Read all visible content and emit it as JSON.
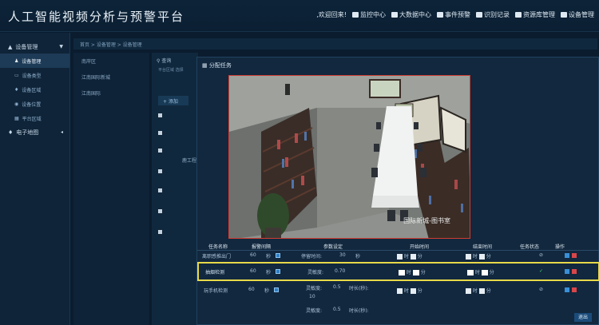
{
  "header": {
    "title": "人工智能视频分析与预警平台",
    "welcome": ",欢迎回来!",
    "nav": [
      "监控中心",
      "大数据中心",
      "事件预警",
      "识别记录",
      "资源库管理",
      "设备管理"
    ]
  },
  "sidebar": {
    "items": [
      {
        "label": "设备管理",
        "icon": "thumbs-up-icon"
      },
      {
        "label": "设备管理",
        "icon": "person-icon"
      },
      {
        "label": "设备类型",
        "icon": "monitor-icon"
      },
      {
        "label": "设备区域",
        "icon": "pin-icon"
      },
      {
        "label": "设备位置",
        "icon": "target-icon"
      },
      {
        "label": "平台区域",
        "icon": "grid-icon"
      },
      {
        "label": "电子地图",
        "icon": "pin-icon"
      }
    ]
  },
  "breadcrumb": "首页 > 设备管理 > 设备管理",
  "tree": {
    "items": [
      "南岸区",
      "江南国际新城",
      "江南国际"
    ]
  },
  "mid": {
    "search": "查询",
    "head1": "平台区域",
    "head2": "选择",
    "add": "添加",
    "frag": "鹿工程"
  },
  "modal": {
    "title": "分配任务",
    "camera_label": "国际新城-图书室",
    "columns": [
      "任务名称",
      "报警间隔",
      "参数设定",
      "开始时间",
      "结束时间",
      "任务状态",
      "操作"
    ],
    "rows": [
      {
        "name": "离职感推出门",
        "interval": "60",
        "unit": "秒",
        "param_label": "停留时间:",
        "param_value": "30",
        "param_unit": "秒",
        "status": "⊘"
      },
      {
        "name": "抽烟检测",
        "interval": "60",
        "unit": "秒",
        "param_label": "灵敏度:",
        "param_value": "0.70",
        "status": "✓"
      },
      {
        "name": "玩手机检测",
        "interval": "60",
        "unit": "秒",
        "param_label": "灵敏度:",
        "param_value": "0.5",
        "extra_label": "时长(秒):",
        "extra_value": "10",
        "status": "⊘"
      },
      {
        "param_label": "灵敏度:",
        "param_value": "0.5",
        "extra_label": "时长(秒):"
      }
    ],
    "hour_label": "时",
    "minute_label": "分",
    "exit": "退出"
  }
}
